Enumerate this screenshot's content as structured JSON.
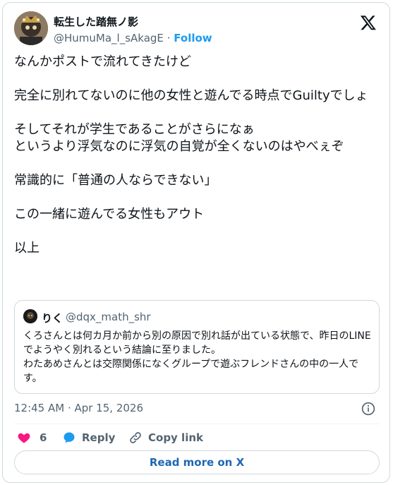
{
  "author": {
    "display_name": "転生した踏無ノ影",
    "handle": "@HumuMa_l_sAkagE",
    "separator": "·",
    "follow_label": "Follow"
  },
  "tweet": {
    "text": "なんかポストで流れてきたけど\n\n完全に別れてないのに他の女性と遊んでる時点でGuiltyでしょ\n\nそしてそれが学生であることがさらになぁ\nというより浮気なのに浮気の自覚が全くないのはやべぇぞ\n\n常識的に「普通の人ならできない」\n\nこの一緒に遊んでる女性もアウト\n\n以上"
  },
  "quote": {
    "display_name": "りく",
    "handle": "@dqx_math_shr",
    "text": "くろさんとは何カ月か前から別の原因で別れ話が出ている状態で、昨日のLINEでようやく別れるという結論に至りました。\nわたあめさんとは交際関係になくグループで遊ぶフレンドさんの中の一人です。"
  },
  "meta": {
    "timestamp": "12:45 AM · Apr 15, 2026"
  },
  "actions": {
    "like_count": "6",
    "reply_label": "Reply",
    "copy_link_label": "Copy link"
  },
  "footer": {
    "read_more_label": "Read more on X"
  },
  "colors": {
    "accent": "#1d9bf0",
    "like": "#f91880",
    "muted": "#536471",
    "border": "#cfd9de"
  }
}
